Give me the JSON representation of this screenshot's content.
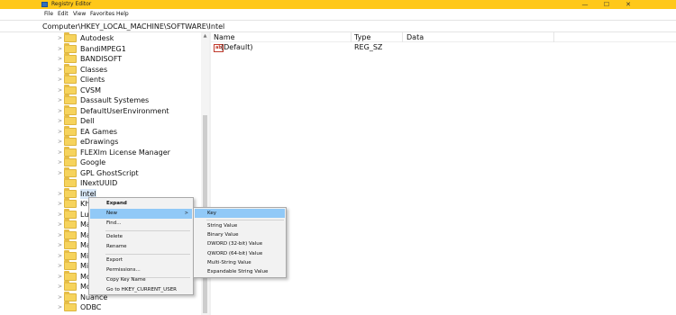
{
  "window": {
    "title": "Registry Editor",
    "minimize_glyph": "—",
    "maximize_glyph": "☐",
    "close_glyph": "✕",
    "accent_color": "#ffc81a"
  },
  "menu": [
    "File",
    "Edit",
    "View",
    "Favorites",
    "Help"
  ],
  "address": "Computer\\HKEY_LOCAL_MACHINE\\SOFTWARE\\Intel",
  "tree": {
    "items": [
      "Autodesk",
      "BandiMPEG1",
      "BANDISOFT",
      "Classes",
      "Clients",
      "CVSM",
      "Dassault Systemes",
      "DefaultUserEnvironment",
      "Dell",
      "EA Games",
      "eDrawings",
      "FLEXlm License Manager",
      "Google",
      "GPL GhostScript",
      "INextUUID",
      "Intel",
      "Khr",
      "Lua",
      "Ma",
      "Ma",
      "Ma",
      "Mic",
      "Mir",
      "Mo",
      "Mo",
      "Nuance",
      "ODBC"
    ],
    "selected": "Intel",
    "expand_glyph": ">"
  },
  "list": {
    "columns": [
      "Name",
      "Type",
      "Data"
    ],
    "rows": [
      {
        "icon": "string-value-icon",
        "icon_glyph": "ab",
        "name": "(Default)",
        "type": "REG_SZ",
        "data": ""
      }
    ]
  },
  "context_menu": {
    "items": [
      "Expand",
      "New",
      "Find...",
      "Delete",
      "Rename",
      "Export",
      "Permissions...",
      "Copy Key Name",
      "Go to HKEY_CURRENT_USER"
    ],
    "submenu_arrow": ">"
  },
  "new_submenu": {
    "items": [
      "Key",
      "String Value",
      "Binary Value",
      "DWORD (32-bit) Value",
      "QWORD (64-bit) Value",
      "Multi-String Value",
      "Expandable String Value"
    ]
  }
}
